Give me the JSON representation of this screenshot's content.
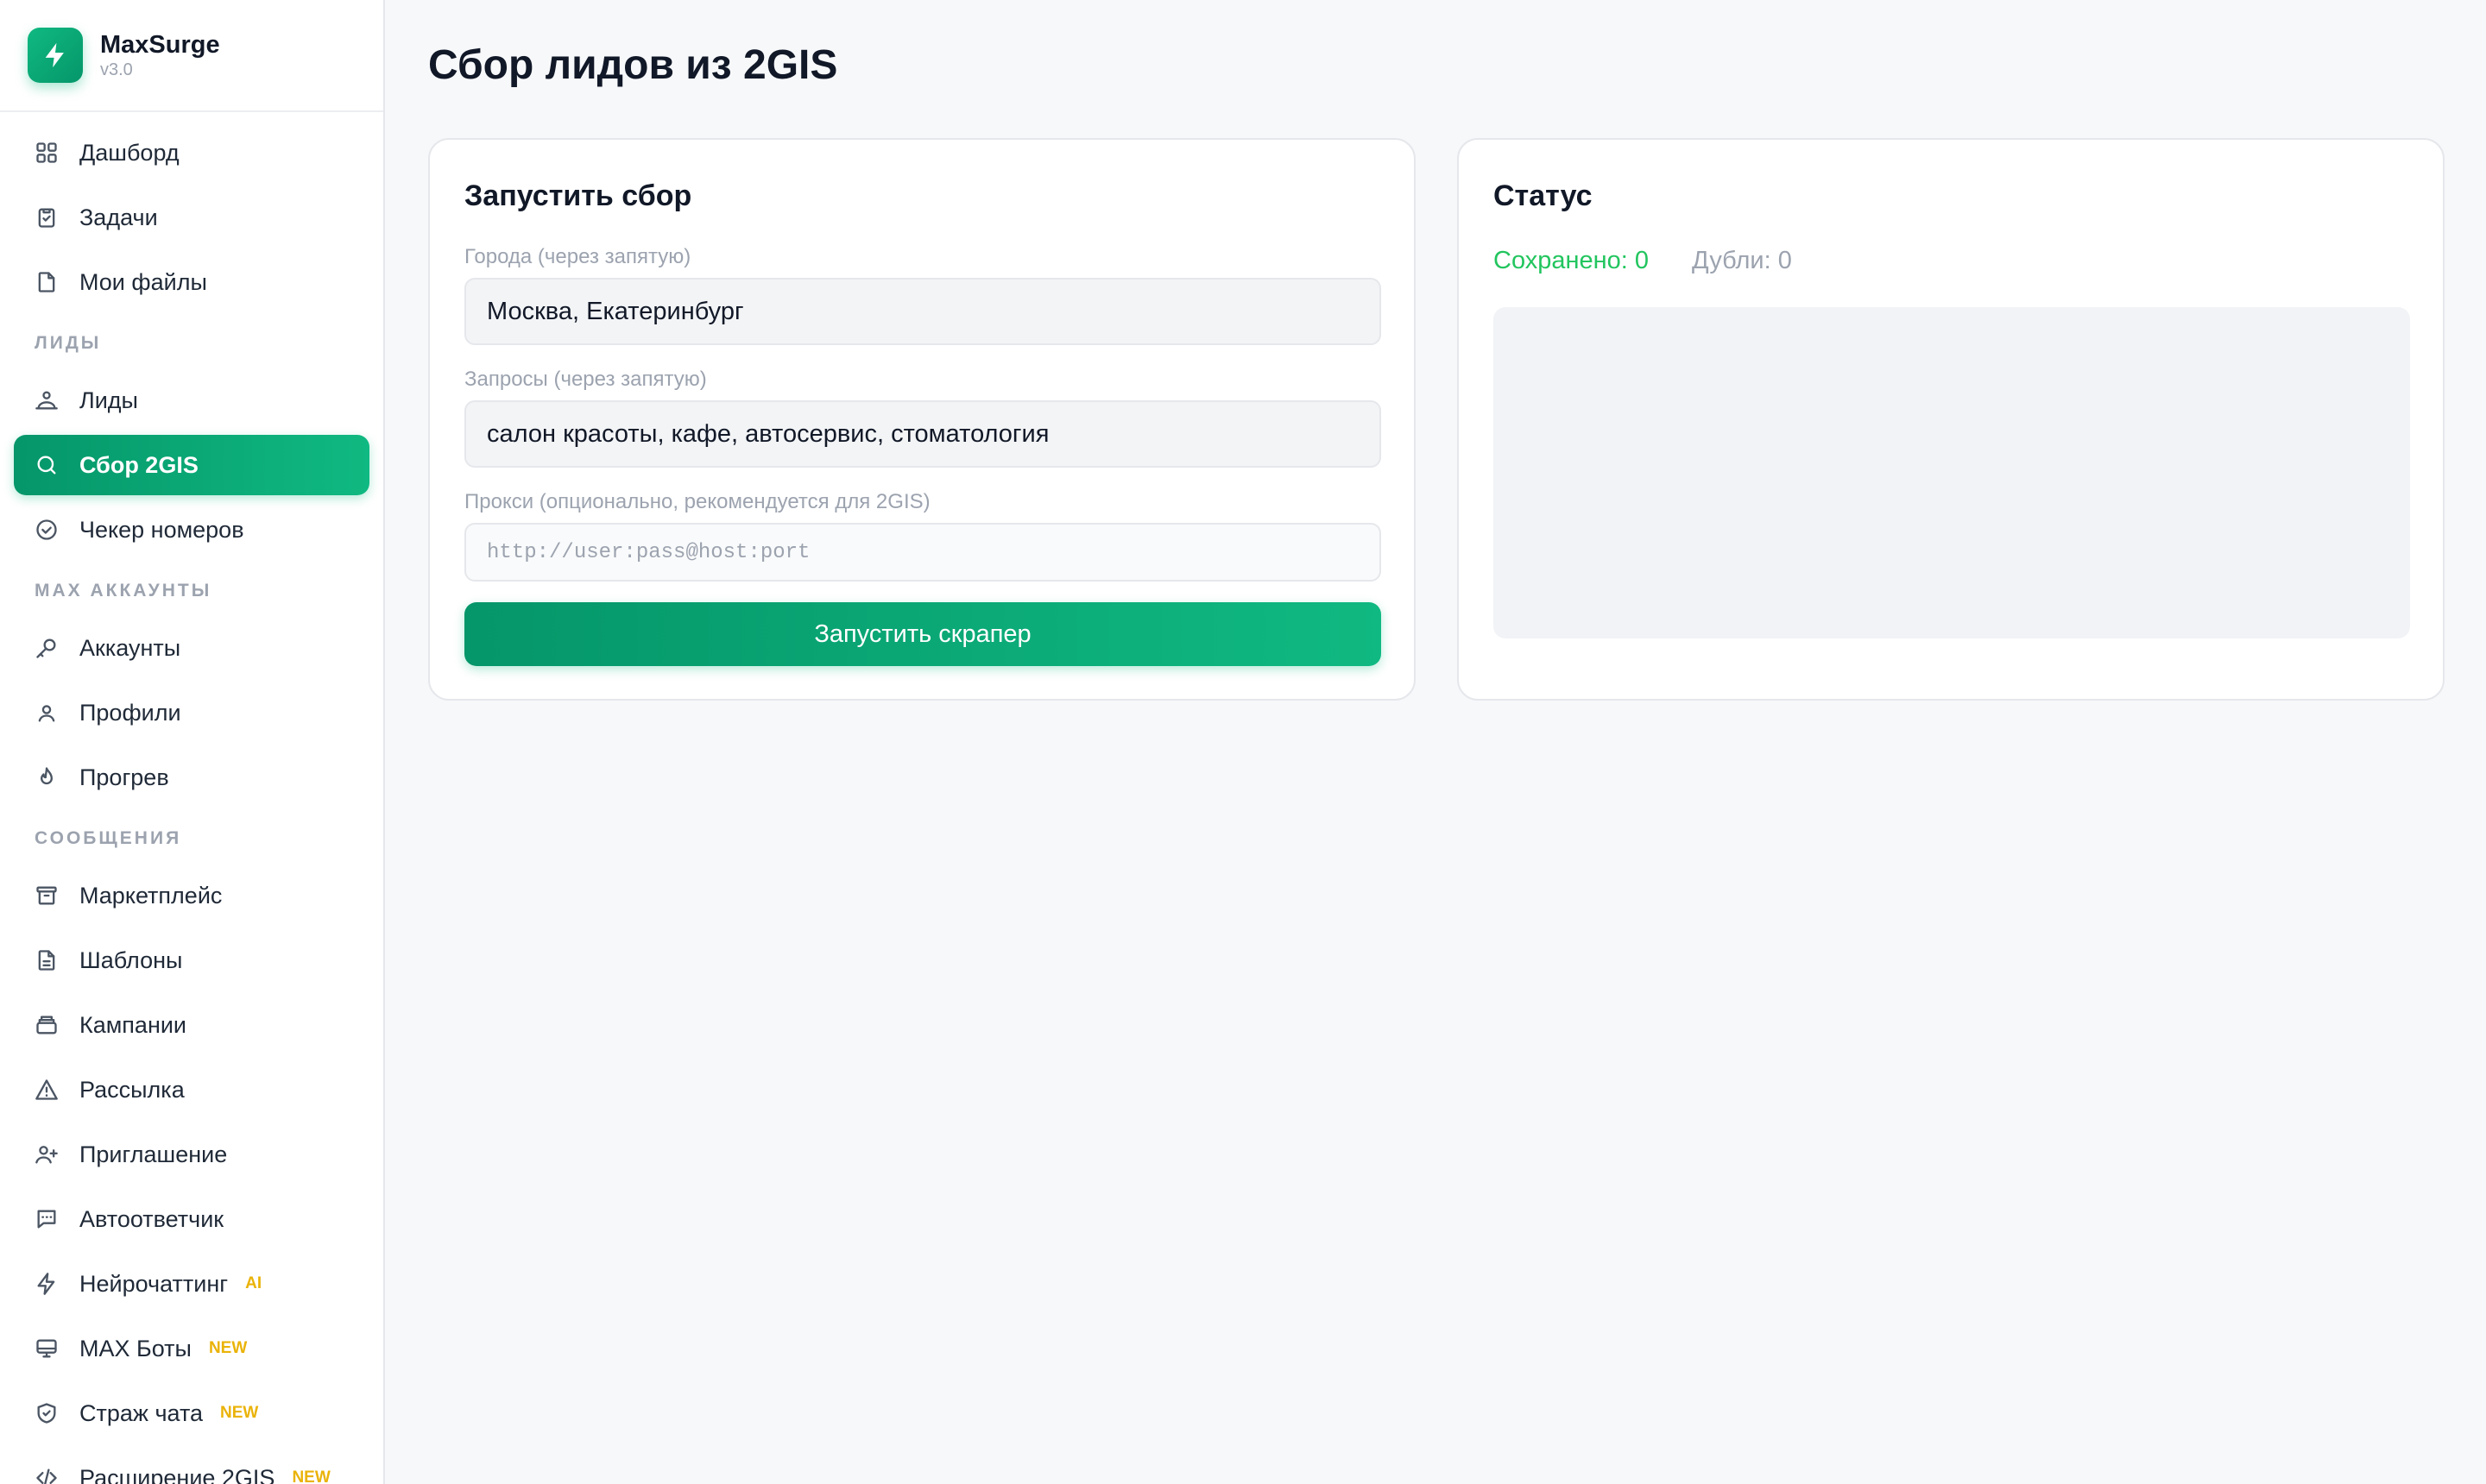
{
  "brand": {
    "name": "MaxSurge",
    "version": "v3.0",
    "accent": "#10b981"
  },
  "nav": {
    "dashboard": "Дашборд",
    "tasks": "Задачи",
    "files": "Мои файлы",
    "section_leads": "ЛИДЫ",
    "leads": "Лиды",
    "scrape_2gis": "Сбор 2GIS",
    "number_checker": "Чекер номеров",
    "section_accounts": "MAX АККАУНТЫ",
    "accounts": "Аккаунты",
    "profiles": "Профили",
    "warmup": "Прогрев",
    "section_messages": "СООБЩЕНИЯ",
    "marketplace": "Маркетплейс",
    "templates": "Шаблоны",
    "campaigns": "Кампании",
    "mailing": "Рассылка",
    "invites": "Приглашение",
    "autoresponder": "Автоответчик",
    "neurochat": "Нейрочаттинг",
    "neurochat_badge": "AI",
    "bots": "MAX Боты",
    "bots_badge": "NEW",
    "chat_guard": "Страж чата",
    "chat_guard_badge": "NEW",
    "extension": "Расширение 2GIS",
    "extension_badge": "NEW"
  },
  "page": {
    "title": "Сбор лидов из 2GIS"
  },
  "form": {
    "title": "Запустить сбор",
    "cities_label": "Города (через запятую)",
    "cities_value": "Москва, Екатеринбург",
    "queries_label": "Запросы (через запятую)",
    "queries_value": "салон красоты, кафе, автосервис, стоматология",
    "proxy_label": "Прокси (опционально, рекомендуется для 2GIS)",
    "proxy_placeholder": "http://user:pass@host:port",
    "submit_label": "Запустить скрапер"
  },
  "status": {
    "title": "Статус",
    "saved": "Сохранено: 0",
    "duplicates": "Дубли: 0"
  }
}
